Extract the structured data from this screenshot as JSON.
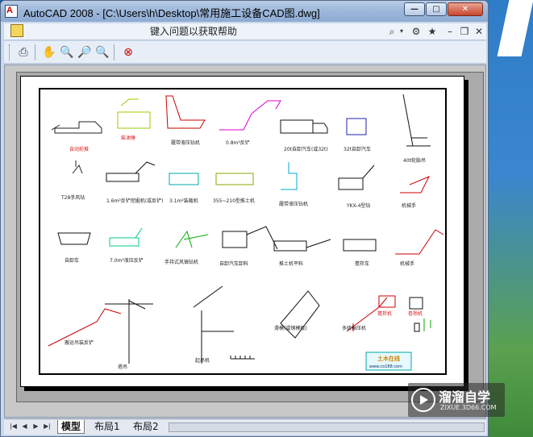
{
  "window": {
    "title": "AutoCAD 2008 - [C:\\Users\\h\\Desktop\\常用施工设备CAD图.dwg]",
    "buttons": {
      "minimize": "—",
      "maximize": "□",
      "close": "✕"
    }
  },
  "menubar": {
    "help_placeholder": "键入问题以获取帮助",
    "icons": [
      "binoculars-icon",
      "dropdown-icon",
      "communication-center-icon",
      "favorites-star-icon",
      "doc-minimize-icon",
      "doc-restore-icon",
      "doc-close-icon"
    ]
  },
  "toolbar": {
    "icons": [
      "pan-icon",
      "zoom-realtime-icon",
      "zoom-window-icon",
      "zoom-previous-icon",
      "close-preview-icon"
    ]
  },
  "drawing": {
    "labels": [
      "自动前推",
      "柴油锤",
      "履带液压钻机",
      "0.8m²反铲",
      "20t自卸汽车(或32t)",
      "32t自卸汽车",
      "40t轮胎吊",
      "T28手风钻",
      "1.6m²反铲挖掘机(或反铲)",
      "3.1m²装载机",
      "355~210型推土机",
      "履带液压钻机",
      "YKX-4型钻",
      "机械手",
      "自卸车",
      "7.0m²液压反铲",
      "手持式风镐钻机",
      "自卸汽车卸料",
      "推土机平料",
      "搅拌车",
      "机械手",
      "搬运吊装反铲",
      "塔吊",
      "起吊机",
      "滑模(或钢模板)",
      "多级振压机",
      "搅拌机",
      "卷扬机"
    ],
    "stamp": "土木在线",
    "stamp_url": "www.co188.com"
  },
  "statusbar": {
    "tabs": [
      "模型",
      "布局1",
      "布局2"
    ]
  },
  "watermark": {
    "title": "溜溜自学",
    "url": "ZIXUE.3D66.COM"
  },
  "colors": {
    "accent": "#2d6fb3",
    "close": "#c7452d"
  }
}
